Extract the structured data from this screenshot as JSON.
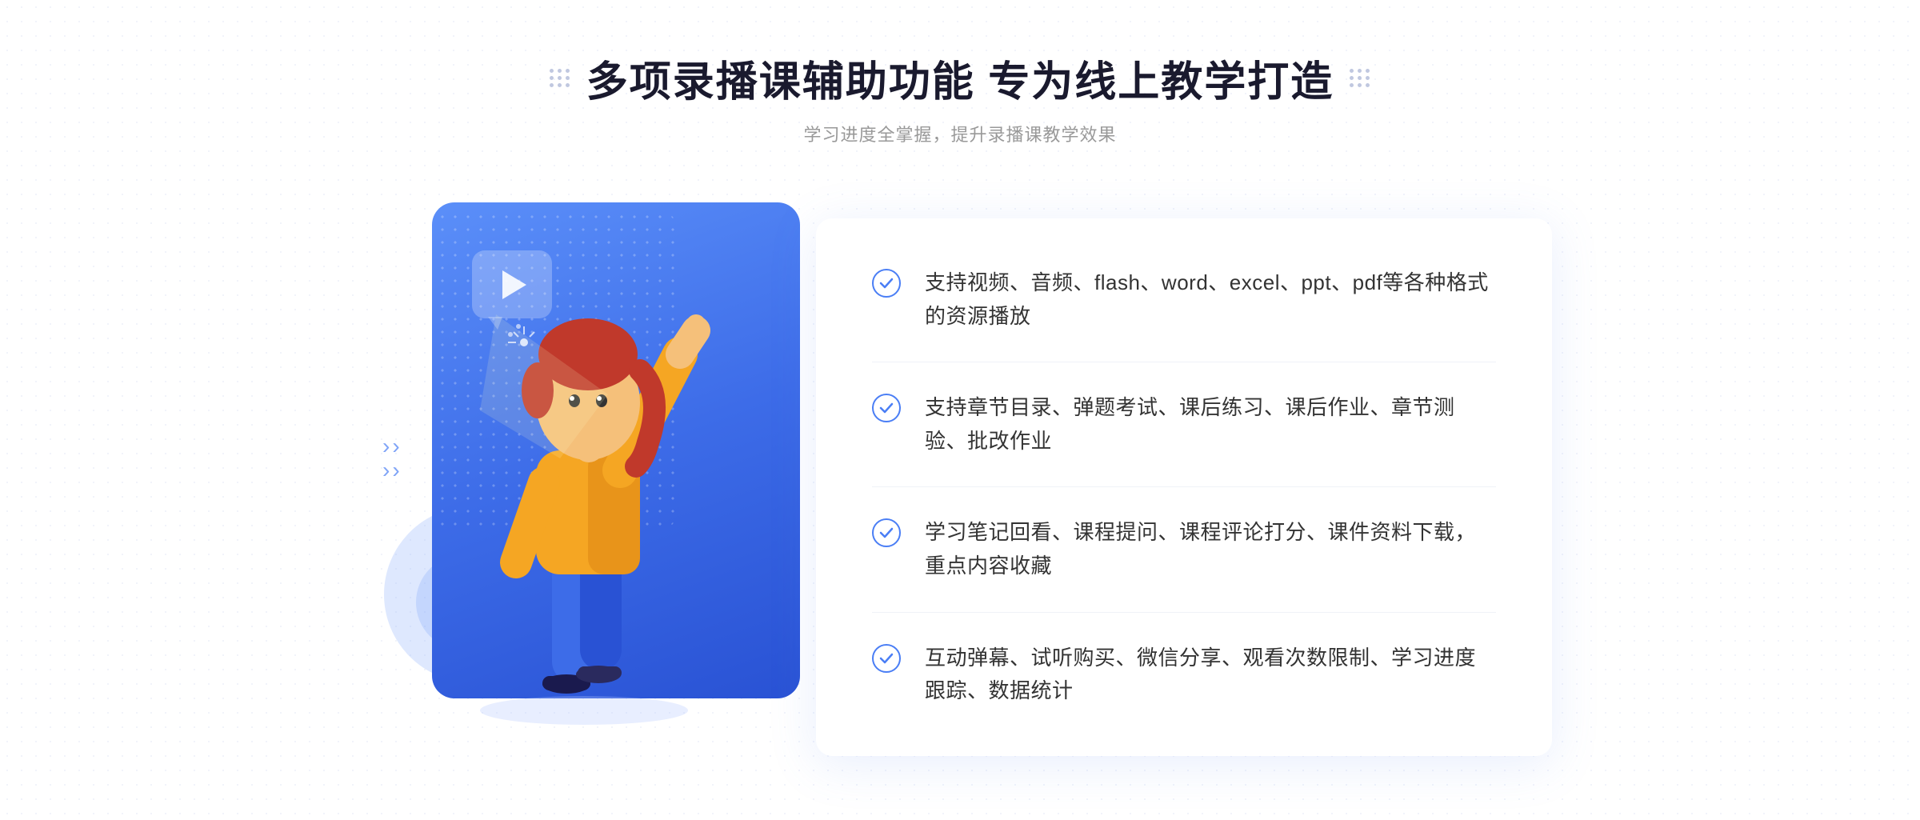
{
  "header": {
    "title": "多项录播课辅助功能 专为线上教学打造",
    "subtitle": "学习进度全掌握，提升录播课教学效果"
  },
  "features": [
    {
      "id": 1,
      "text": "支持视频、音频、flash、word、excel、ppt、pdf等各种格式的资源播放"
    },
    {
      "id": 2,
      "text": "支持章节目录、弹题考试、课后练习、课后作业、章节测验、批改作业"
    },
    {
      "id": 3,
      "text": "学习笔记回看、课程提问、课程评论打分、课件资料下载，重点内容收藏"
    },
    {
      "id": 4,
      "text": "互动弹幕、试听购买、微信分享、观看次数限制、学习进度跟踪、数据统计"
    }
  ],
  "colors": {
    "primary_blue": "#4a7ef5",
    "dark_blue": "#2952d4",
    "light_blue": "#5b8ff9",
    "text_dark": "#1a1a2e",
    "text_gray": "#999999",
    "text_body": "#333333"
  }
}
